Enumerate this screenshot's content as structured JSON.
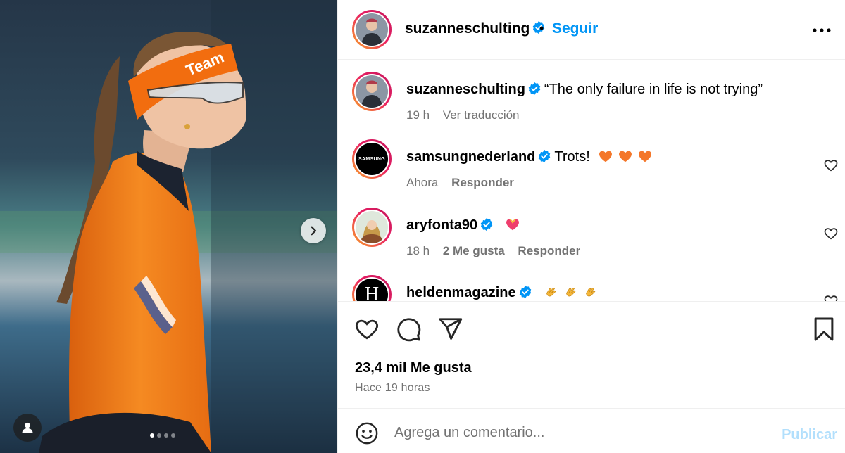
{
  "post": {
    "author": "suzanneschulting",
    "follow_label": "Seguir",
    "bullet": "•",
    "caption": {
      "user": "suzanneschulting",
      "text": "“The only failure in life is not trying”",
      "time": "19 h",
      "translate": "Ver traducción"
    },
    "comments": [
      {
        "user": "samsungnederland",
        "text": "Trots!",
        "emojis": [
          "orange-heart",
          "orange-heart",
          "orange-heart"
        ],
        "time": "Ahora",
        "likes": "",
        "reply": "Responder",
        "avatar_label": "SAMSUNG"
      },
      {
        "user": "aryfonta90",
        "text": "",
        "emojis": [
          "heart-with-ribbon"
        ],
        "time": "18 h",
        "likes": "2 Me gusta",
        "reply": "Responder",
        "avatar_label": ""
      },
      {
        "user": "heldenmagazine",
        "text": "",
        "emojis": [
          "clapping-hands",
          "clapping-hands",
          "clapping-hands"
        ],
        "time": "",
        "likes": "",
        "reply": "",
        "avatar_label": "H"
      }
    ],
    "likes_count": "23,4 mil Me gusta",
    "posted_ago": "Hace 19 horas",
    "media": {
      "carousel_total": 4,
      "carousel_active": 1,
      "headband_text": "Team"
    }
  },
  "composer": {
    "placeholder": "Agrega un comentario...",
    "publish_label": "Publicar"
  },
  "icons": {
    "verified": "verified-badge-icon",
    "more": "more-options-icon",
    "like": "heart-icon",
    "comment": "comment-icon",
    "share": "share-icon",
    "save": "bookmark-icon",
    "emoji": "emoji-icon",
    "next": "chevron-right-icon",
    "tag": "user-tag-icon"
  },
  "colors": {
    "accent": "#0095f6",
    "publish_disabled": "#b2dffc",
    "muted": "#737373",
    "verified": "#0095f6",
    "story_ring_start": "#f9a825",
    "story_ring_end": "#c2185b",
    "suit_orange": "#f07a1a"
  }
}
